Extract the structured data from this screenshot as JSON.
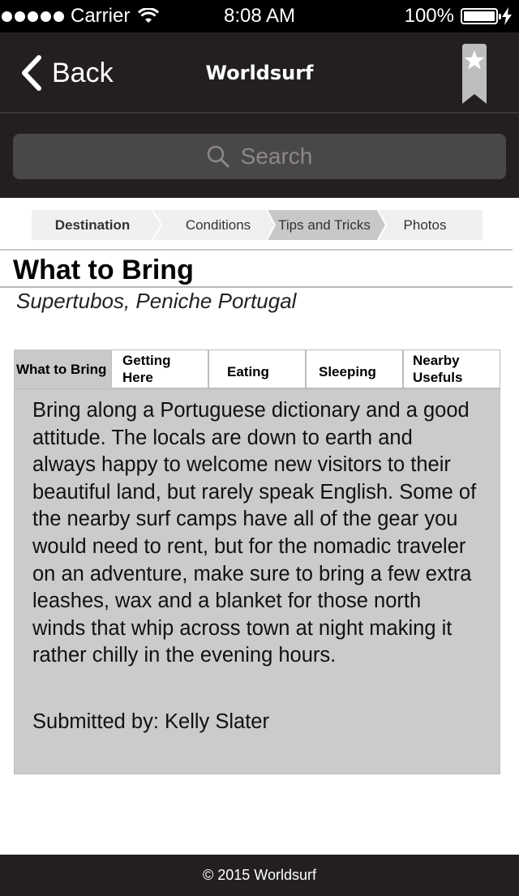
{
  "status_bar": {
    "carrier": "Carrier",
    "time": "8:08 AM",
    "battery": "100%"
  },
  "nav": {
    "back_label": "Back",
    "title": "Worldsurf",
    "bookmark_icon": "bookmark-star-icon"
  },
  "search": {
    "placeholder": "Search"
  },
  "steps": [
    {
      "label": "Destination"
    },
    {
      "label": "Conditions"
    },
    {
      "label": "Tips and Tricks"
    },
    {
      "label": "Photos"
    }
  ],
  "page": {
    "title": "What to Bring",
    "subtitle": "Supertubos, Peniche Portugal"
  },
  "tabs": [
    {
      "label": "What to Bring"
    },
    {
      "label": "Getting Here"
    },
    {
      "label": "Eating"
    },
    {
      "label": "Sleeping"
    },
    {
      "label": "Nearby Usefuls"
    }
  ],
  "content": {
    "body": "Bring along a Portuguese dictionary and a good attitude. The locals are down to earth and always happy to welcome new visitors to their beautiful land, but rarely speak English. Some of the nearby surf camps have all of the gear you would need to rent, but for the nomadic traveler on an adventure, make sure to bring a few extra leashes, wax and a blanket for those north winds that whip across town at night making it rather chilly in the evening hours.",
    "submitted": "Submitted by: Kelly Slater"
  },
  "footer": {
    "text": "© 2015 Worldsurf"
  },
  "colors": {
    "header_bg": "#231f20",
    "panel_bg": "#cbcbcb",
    "search_bg": "#4a4748"
  }
}
